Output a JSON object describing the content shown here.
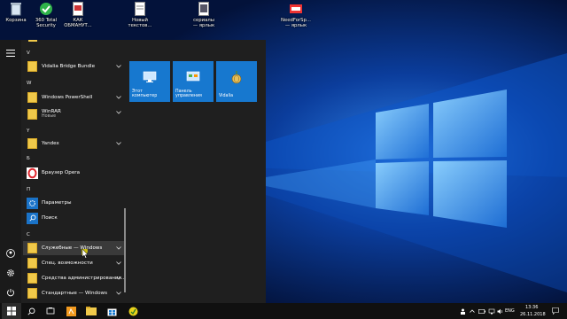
{
  "desktop": {
    "icons": [
      {
        "name": "recycle-bin",
        "label": "Корзина"
      },
      {
        "name": "360-total-security",
        "label": "360 Total\nSecurity"
      },
      {
        "name": "kak-obmanut",
        "label": "КАК\nОБМАНУТ..."
      },
      {
        "name": "new-text-doc",
        "label": "Новый\nтекстов..."
      },
      {
        "name": "serialy-shortcut",
        "label": "сериалы\n— ярлык"
      },
      {
        "name": "needforspeed-shortcut",
        "label": "NeedForSp...\n— ярлык"
      }
    ]
  },
  "start_menu": {
    "groups": [
      {
        "letter": "V"
      },
      {
        "letter": "W"
      },
      {
        "letter": "Y"
      },
      {
        "letter": "Б"
      },
      {
        "letter": "П"
      },
      {
        "letter": "С"
      }
    ],
    "apps": [
      {
        "label": "Vidalia Bridge Bundle",
        "has_chevron": true
      },
      {
        "label": "Windows PowerShell",
        "has_chevron": true
      },
      {
        "label": "WinRAR",
        "sub": "Новые",
        "has_chevron": true
      },
      {
        "label": "Yandex",
        "has_chevron": true
      },
      {
        "label": "Браузер Opera",
        "has_chevron": false
      },
      {
        "label": "Параметры",
        "has_chevron": false
      },
      {
        "label": "Поиск",
        "has_chevron": false
      },
      {
        "label": "Служебные — Windows",
        "has_chevron": true
      },
      {
        "label": "Спец. возможности",
        "has_chevron": true
      },
      {
        "label": "Средства администрирования...",
        "has_chevron": true
      },
      {
        "label": "Стандартные — Windows",
        "has_chevron": true
      }
    ],
    "tiles": [
      {
        "label": "Этот\nкомпьютер",
        "icon": "computer-icon"
      },
      {
        "label": "Панель\nуправления",
        "icon": "control-panel-icon"
      },
      {
        "label": "Vidalia",
        "icon": "onion-icon"
      }
    ]
  },
  "taskbar": {
    "lang": "ENG",
    "time": "13:36",
    "date": "26.11.2018"
  },
  "colors": {
    "accent": "#1778cf",
    "menu_bg": "#1f1f1f",
    "taskbar_bg": "#101010"
  }
}
